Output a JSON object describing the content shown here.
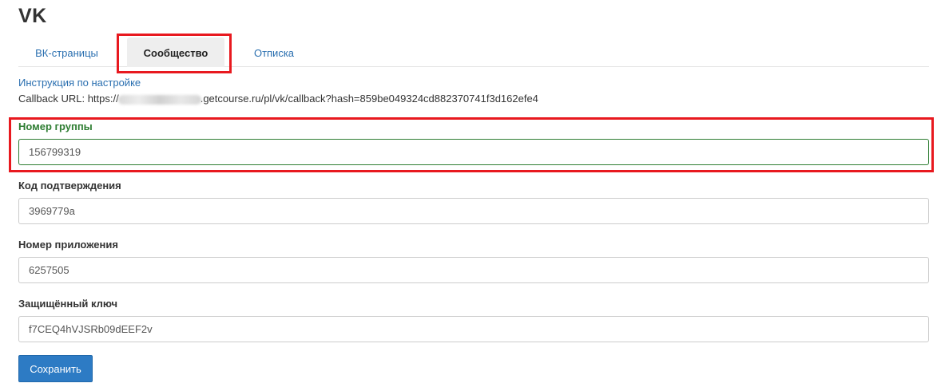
{
  "page": {
    "title": "VK"
  },
  "tabs": {
    "vk_pages": "ВК-страницы",
    "community": "Сообщество",
    "unsubscribe": "Отписка",
    "active": "community"
  },
  "help": {
    "instruction_link": "Инструкция по настройке",
    "callback_prefix": "Callback URL: https://",
    "callback_suffix": ".getcourse.ru/pl/vk/callback?hash=859be049324cd882370741f3d162efe4"
  },
  "form": {
    "group_number": {
      "label": "Номер группы",
      "value": "156799319"
    },
    "confirm_code": {
      "label": "Код подтверждения",
      "value": "3969779a"
    },
    "app_number": {
      "label": "Номер приложения",
      "value": "6257505"
    },
    "secret_key": {
      "label": "Защищённый ключ",
      "value": "f7CEQ4hVJSRb09dEEF2v"
    }
  },
  "actions": {
    "save": "Сохранить"
  },
  "colors": {
    "link": "#2a6fb0",
    "accent_green": "#2e7d32",
    "highlight": "#e8191f",
    "button": "#2d7bc4"
  }
}
